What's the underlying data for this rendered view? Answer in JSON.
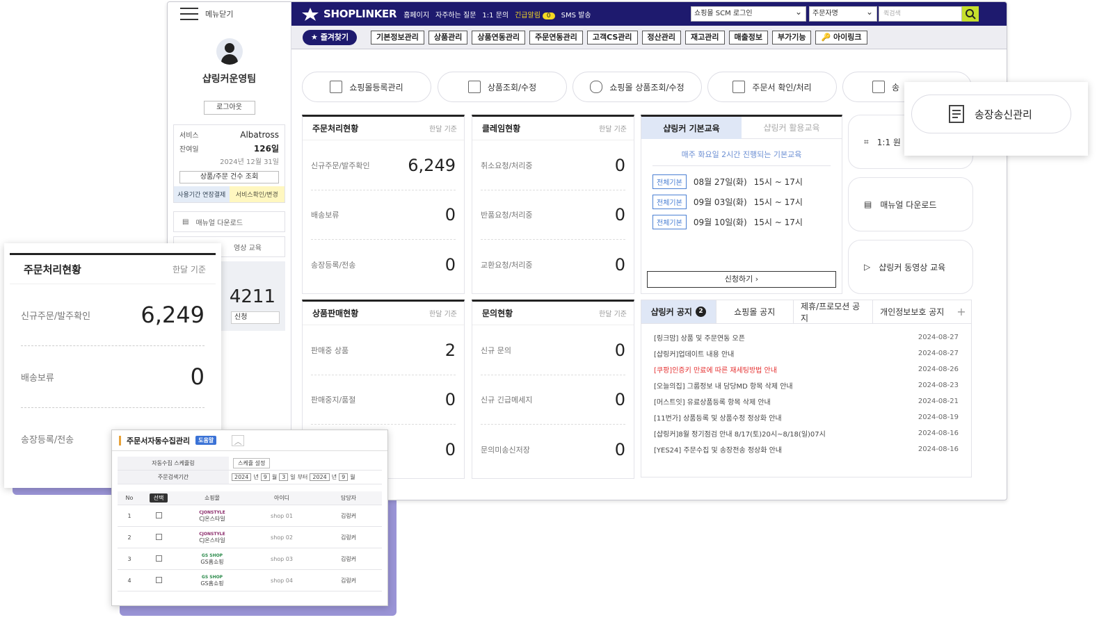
{
  "sidebar": {
    "menu_close": "메뉴닫기",
    "team_name": "샵링커운영팀",
    "logout": "로그아웃",
    "service_label": "서비스",
    "service_value": "Albatross",
    "remaining_label": "잔여일",
    "remaining_value": "126일",
    "remaining_date": "2024년 12월 31일",
    "order_count_btn": "상품/주문 건수 조회",
    "extend_btn": "사용기간 연장결제",
    "confirm_btn": "서비스확인/변경",
    "manual_download": "매뉴얼 다운로드",
    "video_edu": "영상 교육",
    "partial_number": "4211",
    "partial_btn": "신청"
  },
  "topbar": {
    "logo": "SHOPLINKER",
    "links": [
      "홈페이지",
      "자주하는 질문",
      "1:1 문의",
      "긴급알림",
      "SMS 발송"
    ],
    "urgent_count": "0",
    "scm_select": "쇼핑몰 SCM 로그인",
    "search_type": "주문자명",
    "search_placeholder": "퀵검색"
  },
  "nav": {
    "favorites": "★ 즐겨찾기",
    "items": [
      "기본정보관리",
      "상품관리",
      "상품연동관리",
      "주문연동관리",
      "고객CS관리",
      "정산관리",
      "재고관리",
      "매출정보",
      "부가기능"
    ],
    "ilink": "아이링크"
  },
  "quick": [
    "쇼핑몰등록관리",
    "상품조회/수정",
    "쇼핑몰 상품조회/수정",
    "주문서 확인/처리",
    "송"
  ],
  "panels": {
    "order": {
      "title": "주문처리현황",
      "sub": "한달 기준",
      "rows": [
        {
          "label": "신규주문/발주확인",
          "value": "6,249"
        },
        {
          "label": "배송보류",
          "value": "0"
        },
        {
          "label": "송장등록/전송",
          "value": "0"
        }
      ]
    },
    "claim": {
      "title": "클레임현황",
      "sub": "한달 기준",
      "rows": [
        {
          "label": "취소요청/처리중",
          "value": "0"
        },
        {
          "label": "반품요청/처리중",
          "value": "0"
        },
        {
          "label": "교환요청/처리중",
          "value": "0"
        }
      ]
    },
    "sales": {
      "title": "상품판매현황",
      "sub": "한달 기준",
      "rows": [
        {
          "label": "판매중 상품",
          "value": "2"
        },
        {
          "label": "판매중지/품절",
          "value": "0"
        },
        {
          "label": "",
          "value": "0"
        }
      ]
    },
    "inquiry": {
      "title": "문의현황",
      "sub": "한달 기준",
      "rows": [
        {
          "label": "신규 문의",
          "value": "0"
        },
        {
          "label": "신규 긴급메세지",
          "value": "0"
        },
        {
          "label": "문의미송신저장",
          "value": "0"
        }
      ]
    }
  },
  "education": {
    "tab_on": "샵링커 기본교육",
    "tab_off": "샵링커 활용교육",
    "subtitle": "매주 화요일 2시간 진행되는 기본교육",
    "tag": "전체기본",
    "sessions": [
      {
        "date": "08월 27일(화)",
        "time": "15시 ~ 17시"
      },
      {
        "date": "09월 03일(화)",
        "time": "15시 ~ 17시"
      },
      {
        "date": "09월 10일(화)",
        "time": "15시 ~ 17시"
      }
    ],
    "apply": "신청하기 ›"
  },
  "side_cards": [
    "1:1 원",
    "매뉴얼 다운로드",
    "샵링커 동영상 교육"
  ],
  "notice": {
    "tabs": [
      "샵링커 공지",
      "쇼핑몰 공지",
      "제휴/프로모션 공지",
      "개인정보보호 공지"
    ],
    "badge": "2",
    "plus": "+",
    "items": [
      {
        "title": "[링크맘] 상품 및 주문연동 오픈",
        "date": "2024-08-27"
      },
      {
        "title": "[샵링커]업데이트 내용 안내",
        "date": "2024-08-27"
      },
      {
        "title": "[쿠팡]인증키 만료에 따른 재세팅방법 안내",
        "date": "2024-08-26"
      },
      {
        "title": "[오늘의집] 그룹정보 내 담당MD 항목 삭제 안내",
        "date": "2024-08-23"
      },
      {
        "title": "[머스트잇] 유료상품등록 항목 삭제 안내",
        "date": "2024-08-21"
      },
      {
        "title": "[11번가] 상품등록 및 상품수정 정상화 안내",
        "date": "2024-08-19"
      },
      {
        "title": "[샵링커]8월 정기점검 안내 8/17(토)20시~8/18(일)07시",
        "date": "2024-08-16"
      },
      {
        "title": "[YES24] 주문수집 및 송장전송 정상화 안내",
        "date": "2024-08-16"
      }
    ]
  },
  "float_invoice": "송장송신관리",
  "float_order": {
    "title": "주문처리현황",
    "sub": "한달 기준",
    "rows": [
      {
        "label": "신규주문/발주확인",
        "value": "6,249"
      },
      {
        "label": "배송보류",
        "value": "0"
      },
      {
        "label": "송장등록/전송",
        "value": ""
      }
    ]
  },
  "auto_collect": {
    "title": "주문서자동수집관리",
    "help": "도움말",
    "schedule_label": "자동수집 스케쥴링",
    "schedule_btn": "스케쥴 설정",
    "period_label": "주문검색기간",
    "period": {
      "y1": "2024",
      "m1": "9",
      "d1": "3",
      "y2": "2024",
      "m2": "9"
    },
    "period_text": {
      "year": "년",
      "month": "월",
      "day": "일",
      "from": "부터"
    },
    "headers": [
      "No",
      "선택",
      "쇼핑몰",
      "아이디",
      "담당자"
    ],
    "rows": [
      {
        "no": "1",
        "mall_logo": "CJONSTYLE",
        "mall": "CJ온스타일",
        "id": "shop 01",
        "manager": "김링커"
      },
      {
        "no": "2",
        "mall_logo": "CJONSTYLE",
        "mall": "CJ온스타일",
        "id": "shop 02",
        "manager": "김링커"
      },
      {
        "no": "3",
        "mall_logo": "GS SHOP",
        "mall": "GS홈쇼핑",
        "id": "shop 03",
        "manager": "김링커"
      },
      {
        "no": "4",
        "mall_logo": "GS SHOP",
        "mall": "GS홈쇼핑",
        "id": "shop 04",
        "manager": "김링커"
      }
    ]
  }
}
